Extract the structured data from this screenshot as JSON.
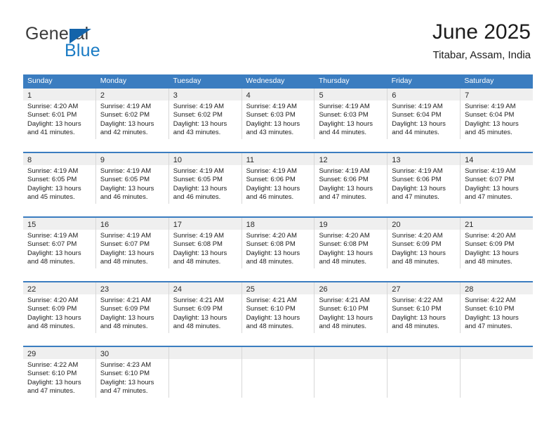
{
  "brand": {
    "general": "General",
    "blue": "Blue",
    "triangle_icon": "blue-triangle-icon",
    "accent_blue": "#1a7bc4",
    "triangle_blue": "#1464aa"
  },
  "header": {
    "title": "June 2025",
    "subtitle": "Titabar, Assam, India"
  },
  "calendar": {
    "header_bg": "#3b7dc0",
    "header_text_color": "#ffffff",
    "daynum_band_bg": "#efefef",
    "row_border_color": "#3b7dc0",
    "cell_divider_color": "#d7d7d7",
    "weekdays": [
      "Sunday",
      "Monday",
      "Tuesday",
      "Wednesday",
      "Thursday",
      "Friday",
      "Saturday"
    ],
    "weeks": [
      [
        {
          "day": "1",
          "sunrise": "Sunrise: 4:20 AM",
          "sunset": "Sunset: 6:01 PM",
          "daylight1": "Daylight: 13 hours",
          "daylight2": "and 41 minutes."
        },
        {
          "day": "2",
          "sunrise": "Sunrise: 4:19 AM",
          "sunset": "Sunset: 6:02 PM",
          "daylight1": "Daylight: 13 hours",
          "daylight2": "and 42 minutes."
        },
        {
          "day": "3",
          "sunrise": "Sunrise: 4:19 AM",
          "sunset": "Sunset: 6:02 PM",
          "daylight1": "Daylight: 13 hours",
          "daylight2": "and 43 minutes."
        },
        {
          "day": "4",
          "sunrise": "Sunrise: 4:19 AM",
          "sunset": "Sunset: 6:03 PM",
          "daylight1": "Daylight: 13 hours",
          "daylight2": "and 43 minutes."
        },
        {
          "day": "5",
          "sunrise": "Sunrise: 4:19 AM",
          "sunset": "Sunset: 6:03 PM",
          "daylight1": "Daylight: 13 hours",
          "daylight2": "and 44 minutes."
        },
        {
          "day": "6",
          "sunrise": "Sunrise: 4:19 AM",
          "sunset": "Sunset: 6:04 PM",
          "daylight1": "Daylight: 13 hours",
          "daylight2": "and 44 minutes."
        },
        {
          "day": "7",
          "sunrise": "Sunrise: 4:19 AM",
          "sunset": "Sunset: 6:04 PM",
          "daylight1": "Daylight: 13 hours",
          "daylight2": "and 45 minutes."
        }
      ],
      [
        {
          "day": "8",
          "sunrise": "Sunrise: 4:19 AM",
          "sunset": "Sunset: 6:05 PM",
          "daylight1": "Daylight: 13 hours",
          "daylight2": "and 45 minutes."
        },
        {
          "day": "9",
          "sunrise": "Sunrise: 4:19 AM",
          "sunset": "Sunset: 6:05 PM",
          "daylight1": "Daylight: 13 hours",
          "daylight2": "and 46 minutes."
        },
        {
          "day": "10",
          "sunrise": "Sunrise: 4:19 AM",
          "sunset": "Sunset: 6:05 PM",
          "daylight1": "Daylight: 13 hours",
          "daylight2": "and 46 minutes."
        },
        {
          "day": "11",
          "sunrise": "Sunrise: 4:19 AM",
          "sunset": "Sunset: 6:06 PM",
          "daylight1": "Daylight: 13 hours",
          "daylight2": "and 46 minutes."
        },
        {
          "day": "12",
          "sunrise": "Sunrise: 4:19 AM",
          "sunset": "Sunset: 6:06 PM",
          "daylight1": "Daylight: 13 hours",
          "daylight2": "and 47 minutes."
        },
        {
          "day": "13",
          "sunrise": "Sunrise: 4:19 AM",
          "sunset": "Sunset: 6:06 PM",
          "daylight1": "Daylight: 13 hours",
          "daylight2": "and 47 minutes."
        },
        {
          "day": "14",
          "sunrise": "Sunrise: 4:19 AM",
          "sunset": "Sunset: 6:07 PM",
          "daylight1": "Daylight: 13 hours",
          "daylight2": "and 47 minutes."
        }
      ],
      [
        {
          "day": "15",
          "sunrise": "Sunrise: 4:19 AM",
          "sunset": "Sunset: 6:07 PM",
          "daylight1": "Daylight: 13 hours",
          "daylight2": "and 48 minutes."
        },
        {
          "day": "16",
          "sunrise": "Sunrise: 4:19 AM",
          "sunset": "Sunset: 6:07 PM",
          "daylight1": "Daylight: 13 hours",
          "daylight2": "and 48 minutes."
        },
        {
          "day": "17",
          "sunrise": "Sunrise: 4:19 AM",
          "sunset": "Sunset: 6:08 PM",
          "daylight1": "Daylight: 13 hours",
          "daylight2": "and 48 minutes."
        },
        {
          "day": "18",
          "sunrise": "Sunrise: 4:20 AM",
          "sunset": "Sunset: 6:08 PM",
          "daylight1": "Daylight: 13 hours",
          "daylight2": "and 48 minutes."
        },
        {
          "day": "19",
          "sunrise": "Sunrise: 4:20 AM",
          "sunset": "Sunset: 6:08 PM",
          "daylight1": "Daylight: 13 hours",
          "daylight2": "and 48 minutes."
        },
        {
          "day": "20",
          "sunrise": "Sunrise: 4:20 AM",
          "sunset": "Sunset: 6:09 PM",
          "daylight1": "Daylight: 13 hours",
          "daylight2": "and 48 minutes."
        },
        {
          "day": "21",
          "sunrise": "Sunrise: 4:20 AM",
          "sunset": "Sunset: 6:09 PM",
          "daylight1": "Daylight: 13 hours",
          "daylight2": "and 48 minutes."
        }
      ],
      [
        {
          "day": "22",
          "sunrise": "Sunrise: 4:20 AM",
          "sunset": "Sunset: 6:09 PM",
          "daylight1": "Daylight: 13 hours",
          "daylight2": "and 48 minutes."
        },
        {
          "day": "23",
          "sunrise": "Sunrise: 4:21 AM",
          "sunset": "Sunset: 6:09 PM",
          "daylight1": "Daylight: 13 hours",
          "daylight2": "and 48 minutes."
        },
        {
          "day": "24",
          "sunrise": "Sunrise: 4:21 AM",
          "sunset": "Sunset: 6:09 PM",
          "daylight1": "Daylight: 13 hours",
          "daylight2": "and 48 minutes."
        },
        {
          "day": "25",
          "sunrise": "Sunrise: 4:21 AM",
          "sunset": "Sunset: 6:10 PM",
          "daylight1": "Daylight: 13 hours",
          "daylight2": "and 48 minutes."
        },
        {
          "day": "26",
          "sunrise": "Sunrise: 4:21 AM",
          "sunset": "Sunset: 6:10 PM",
          "daylight1": "Daylight: 13 hours",
          "daylight2": "and 48 minutes."
        },
        {
          "day": "27",
          "sunrise": "Sunrise: 4:22 AM",
          "sunset": "Sunset: 6:10 PM",
          "daylight1": "Daylight: 13 hours",
          "daylight2": "and 48 minutes."
        },
        {
          "day": "28",
          "sunrise": "Sunrise: 4:22 AM",
          "sunset": "Sunset: 6:10 PM",
          "daylight1": "Daylight: 13 hours",
          "daylight2": "and 47 minutes."
        }
      ],
      [
        {
          "day": "29",
          "sunrise": "Sunrise: 4:22 AM",
          "sunset": "Sunset: 6:10 PM",
          "daylight1": "Daylight: 13 hours",
          "daylight2": "and 47 minutes."
        },
        {
          "day": "30",
          "sunrise": "Sunrise: 4:23 AM",
          "sunset": "Sunset: 6:10 PM",
          "daylight1": "Daylight: 13 hours",
          "daylight2": "and 47 minutes."
        },
        {
          "day": "",
          "sunrise": "",
          "sunset": "",
          "daylight1": "",
          "daylight2": ""
        },
        {
          "day": "",
          "sunrise": "",
          "sunset": "",
          "daylight1": "",
          "daylight2": ""
        },
        {
          "day": "",
          "sunrise": "",
          "sunset": "",
          "daylight1": "",
          "daylight2": ""
        },
        {
          "day": "",
          "sunrise": "",
          "sunset": "",
          "daylight1": "",
          "daylight2": ""
        },
        {
          "day": "",
          "sunrise": "",
          "sunset": "",
          "daylight1": "",
          "daylight2": ""
        }
      ]
    ]
  }
}
